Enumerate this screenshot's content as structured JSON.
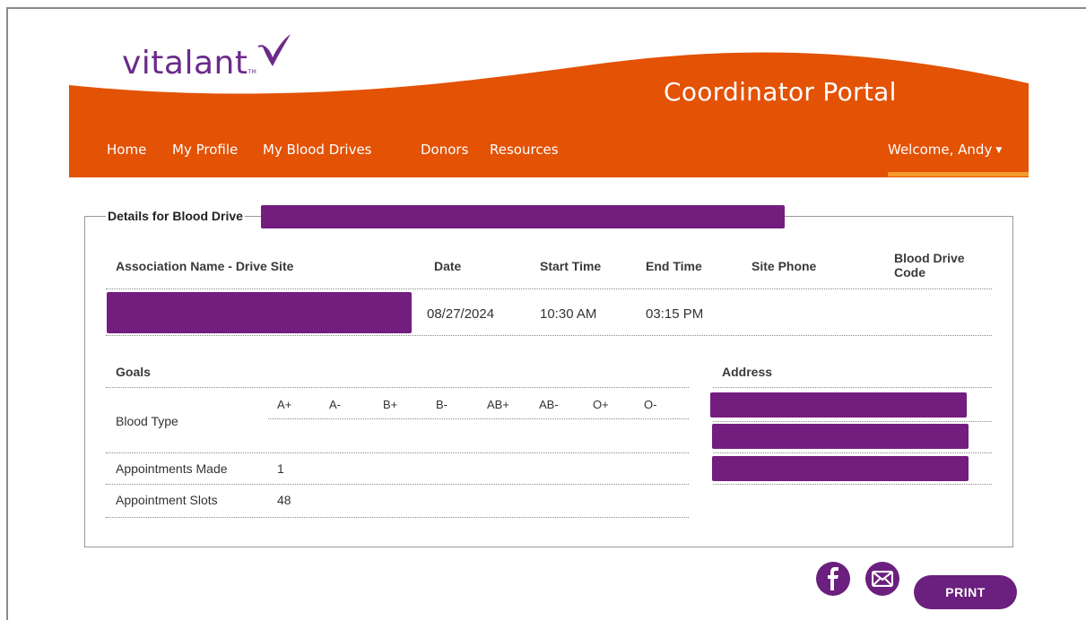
{
  "brand": {
    "name": "vitalant",
    "tm": "TM",
    "portal_title": "Coordinator Portal"
  },
  "nav": {
    "items": [
      {
        "label": "Home"
      },
      {
        "label": "My Profile"
      },
      {
        "label": "My Blood Drives"
      },
      {
        "label": "Donors"
      },
      {
        "label": "Resources"
      }
    ],
    "welcome": "Welcome, Andy"
  },
  "details": {
    "legend": "Details for Blood Drive",
    "columns": {
      "association": "Association Name - Drive Site",
      "date": "Date",
      "start": "Start Time",
      "end": "End Time",
      "phone": "Site Phone",
      "code": "Blood Drive Code"
    },
    "row": {
      "date": "08/27/2024",
      "start": "10:30 AM",
      "end": "03:15 PM",
      "phone": "",
      "code": ""
    }
  },
  "goals": {
    "heading": "Goals",
    "blood_type_label": "Blood Type",
    "blood_types": [
      "A+",
      "A-",
      "B+",
      "B-",
      "AB+",
      "AB-",
      "O+",
      "O-"
    ],
    "appointments_made_label": "Appointments Made",
    "appointments_made": "1",
    "appointment_slots_label": "Appointment Slots",
    "appointment_slots": "48"
  },
  "address": {
    "heading": "Address"
  },
  "actions": {
    "print": "PRINT"
  },
  "colors": {
    "brand_orange": "#e35205",
    "brand_purple": "#6b1f7e",
    "redaction": "#731d7f"
  }
}
